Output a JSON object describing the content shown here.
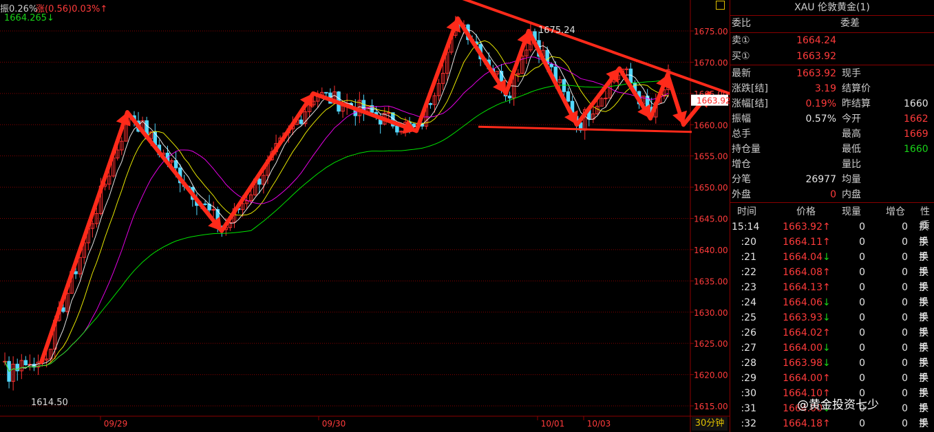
{
  "header": {
    "amplitude": "振0.26%",
    "change": "涨(0.56)0.03%↑",
    "ma_value": "1664.265↓"
  },
  "price_axis": {
    "ticks": [
      "1675.00",
      "1670.00",
      "1665.00",
      "1660.00",
      "1655.00",
      "1650.00",
      "1645.00",
      "1640.00",
      "1635.00",
      "1630.00",
      "1625.00",
      "1620.00",
      "1615.00"
    ],
    "current_price": "1663.92"
  },
  "time_axis": {
    "labels": [
      "09/29",
      "09/30",
      "10/01",
      "10/03"
    ],
    "timeframe": "30分钟"
  },
  "annotations": {
    "high_label": "1675.24",
    "low_label": "1614.50"
  },
  "colors": {
    "up_candle": "#ff3030",
    "down_candle": "#54d8ff",
    "trend_arrow": "#ff2a1a",
    "grid": "#8b0000",
    "ma5": "#ffffff",
    "ma10": "#ffff00",
    "ma20": "#ff00ff",
    "ma60": "#00ff00"
  },
  "panel": {
    "title": "XAU 伦敦黄金(1)",
    "weibi_label": "委比",
    "weicha_label": "委差",
    "sell_label": "卖①",
    "sell_price": "1664.24",
    "buy_label": "买①",
    "buy_price": "1663.92",
    "quote_left": [
      {
        "label": "最新",
        "value": "1663.92",
        "color": "red"
      },
      {
        "label": "涨跌[结]",
        "value": "3.19",
        "color": "red"
      },
      {
        "label": "涨幅[结]",
        "value": "0.19%",
        "color": "red"
      },
      {
        "label": "振幅",
        "value": "0.57%",
        "color": "white"
      },
      {
        "label": "总手",
        "value": "",
        "color": "white"
      },
      {
        "label": "持仓量",
        "value": "",
        "color": "white"
      },
      {
        "label": "增仓",
        "value": "",
        "color": "white"
      },
      {
        "label": "分笔",
        "value": "26977",
        "color": "white"
      },
      {
        "label": "外盘",
        "value": "0",
        "color": "red"
      }
    ],
    "quote_right": [
      {
        "label": "现手",
        "value": "",
        "color": "white"
      },
      {
        "label": "结算价",
        "value": "",
        "color": "white"
      },
      {
        "label": "昨结算",
        "value": "1660",
        "color": "white"
      },
      {
        "label": "今开",
        "value": "1662",
        "color": "red"
      },
      {
        "label": "最高",
        "value": "1669",
        "color": "red"
      },
      {
        "label": "最低",
        "value": "1660",
        "color": "green"
      },
      {
        "label": "量比",
        "value": "",
        "color": "white"
      },
      {
        "label": "均量",
        "value": "",
        "color": "white"
      },
      {
        "label": "内盘",
        "value": "",
        "color": "white"
      }
    ],
    "trades_header": [
      "时间",
      "价格",
      "现量",
      "增仓",
      "性质"
    ],
    "trades": [
      {
        "time": "15:14",
        "price": "1663.92",
        "dir": "↑",
        "qty": "0",
        "oi": "0",
        "nature": "换手"
      },
      {
        "time": ":20",
        "price": "1664.11",
        "dir": "↑",
        "qty": "0",
        "oi": "0",
        "nature": "换手"
      },
      {
        "time": ":21",
        "price": "1664.04",
        "dir": "↓",
        "qty": "0",
        "oi": "0",
        "nature": "换手"
      },
      {
        "time": ":22",
        "price": "1664.08",
        "dir": "↑",
        "qty": "0",
        "oi": "0",
        "nature": "换手"
      },
      {
        "time": ":23",
        "price": "1664.13",
        "dir": "↑",
        "qty": "0",
        "oi": "0",
        "nature": "换手"
      },
      {
        "time": ":24",
        "price": "1664.06",
        "dir": "↓",
        "qty": "0",
        "oi": "0",
        "nature": "换手"
      },
      {
        "time": ":25",
        "price": "1663.93",
        "dir": "↓",
        "qty": "0",
        "oi": "0",
        "nature": "换手"
      },
      {
        "time": ":26",
        "price": "1664.02",
        "dir": "↑",
        "qty": "0",
        "oi": "0",
        "nature": "换手"
      },
      {
        "time": ":27",
        "price": "1664.00",
        "dir": "↓",
        "qty": "0",
        "oi": "0",
        "nature": "换手"
      },
      {
        "time": ":28",
        "price": "1663.98",
        "dir": "↓",
        "qty": "0",
        "oi": "0",
        "nature": "换手"
      },
      {
        "time": ":29",
        "price": "1664.00",
        "dir": "↑",
        "qty": "0",
        "oi": "0",
        "nature": "换手"
      },
      {
        "time": ":30",
        "price": "1664.10",
        "dir": "↑",
        "qty": "0",
        "oi": "0",
        "nature": "换手"
      },
      {
        "time": ":31",
        "price": "1664.00",
        "dir": "↓",
        "qty": "0",
        "oi": "0",
        "nature": "换手"
      },
      {
        "time": ":32",
        "price": "1664.18",
        "dir": "↑",
        "qty": "0",
        "oi": "0",
        "nature": "换手"
      }
    ]
  },
  "watermark": "@黄金投资七少",
  "chart_data": {
    "type": "candlestick",
    "ylim": [
      1612,
      1680
    ],
    "key_points": [
      {
        "label": "low",
        "value": 1614.5
      },
      {
        "label": "high",
        "value": 1675.24
      }
    ],
    "trend_waypoints": [
      1622,
      1662,
      1643,
      1665,
      1659,
      1677,
      1665,
      1675,
      1660,
      1669,
      1661,
      1668,
      1660,
      1665
    ],
    "resistance_line": [
      1679,
      1665
    ],
    "support_line": [
      1660,
      1659.5
    ]
  }
}
